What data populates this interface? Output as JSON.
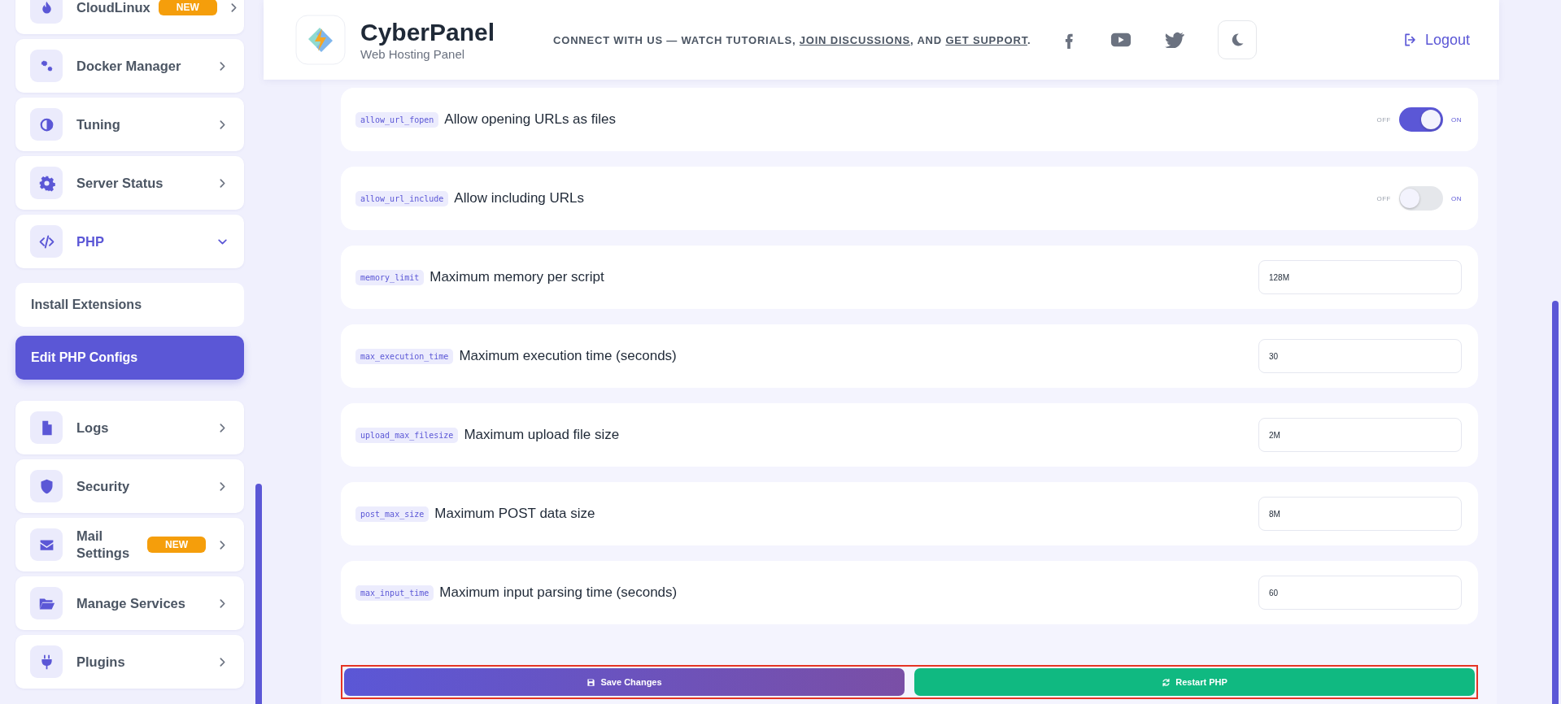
{
  "sidebar": {
    "items": [
      {
        "label": "CloudLinux",
        "badge": "NEW",
        "expanded": false
      },
      {
        "label": "Docker Manager",
        "expanded": false
      },
      {
        "label": "Tuning",
        "expanded": false
      },
      {
        "label": "Server Status",
        "expanded": false
      },
      {
        "label": "PHP",
        "expanded": true,
        "children": [
          {
            "label": "Install Extensions",
            "selected": false
          },
          {
            "label": "Edit PHP Configs",
            "selected": true
          }
        ]
      },
      {
        "label": "Logs",
        "expanded": false
      },
      {
        "label": "Security",
        "expanded": false
      },
      {
        "label": "Mail Settings",
        "badge": "NEW",
        "expanded": false
      },
      {
        "label": "Manage Services",
        "expanded": false
      },
      {
        "label": "Plugins",
        "expanded": false
      }
    ]
  },
  "header": {
    "brand": "CyberPanel",
    "tagline": "Web Hosting Panel",
    "connect": {
      "lead": "CONNECT WITH US — WATCH TUTORIALS,",
      "link_1": "JOIN DISCUSSIONS",
      "middle": ", AND",
      "link_2": "GET SUPPORT",
      "end": "."
    },
    "logout": "Logout"
  },
  "settings": [
    {
      "kind": "toggle",
      "code": "allow_url_fopen",
      "label": "Allow opening URLs as files",
      "off_label": "OFF",
      "on_label": "ON",
      "on": true
    },
    {
      "kind": "toggle",
      "code": "allow_url_include",
      "label": "Allow including URLs",
      "off_label": "OFF",
      "on_label": "ON",
      "on": false
    },
    {
      "kind": "input",
      "code": "memory_limit",
      "label": "Maximum memory per script",
      "value": "128M"
    },
    {
      "kind": "input",
      "code": "max_execution_time",
      "label": "Maximum execution time (seconds)",
      "value": "30"
    },
    {
      "kind": "input",
      "code": "upload_max_filesize",
      "label": "Maximum upload file size",
      "value": "2M"
    },
    {
      "kind": "input",
      "code": "post_max_size",
      "label": "Maximum POST data size",
      "value": "8M"
    },
    {
      "kind": "input",
      "code": "max_input_time",
      "label": "Maximum input parsing time (seconds)",
      "value": "60"
    }
  ],
  "actions": [
    {
      "kind": "save",
      "label": "Save Changes"
    },
    {
      "kind": "restart",
      "label": "Restart PHP"
    }
  ]
}
